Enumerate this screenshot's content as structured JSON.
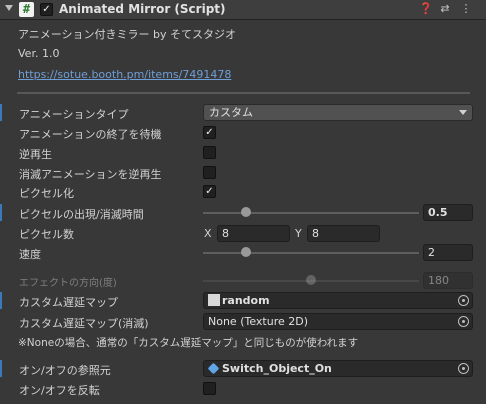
{
  "header": {
    "title": "Animated Mirror (Script)",
    "icons": [
      "fold-arrow-icon",
      "script-icon",
      "help-icon",
      "preset-icon",
      "kebab-menu-icon"
    ],
    "enabled": true
  },
  "info": {
    "description": "アニメーション付きミラー by そてスタジオ",
    "version": "Ver. 1.0",
    "link": "https://sotue.booth.pm/items/7491478"
  },
  "props": {
    "anim_type": {
      "label": "アニメーションタイプ",
      "value": "カスタム"
    },
    "wait_end": {
      "label": "アニメーションの終了を待機",
      "checked": true
    },
    "reverse": {
      "label": "逆再生",
      "checked": false
    },
    "reverse_vanish": {
      "label": "消滅アニメーションを逆再生",
      "checked": false
    },
    "pixelate": {
      "label": "ピクセル化",
      "checked": true
    },
    "pixel_time": {
      "label": "ピクセルの出現/消滅時間",
      "value": "0.5",
      "fraction": 0.2
    },
    "pixel_count": {
      "label": "ピクセル数",
      "x_label": "X",
      "x": "8",
      "y_label": "Y",
      "y": "8"
    },
    "speed": {
      "label": "速度",
      "value": "2",
      "fraction": 0.2
    },
    "effect_dir": {
      "label": "エフェクトの方向(度)",
      "value": "180",
      "fraction": 0.5
    },
    "custom_delay": {
      "label": "カスタム遅延マップ",
      "value": "random"
    },
    "custom_delay_vanish": {
      "label": "カスタム遅延マップ(消滅)",
      "value": "None (Texture 2D)"
    },
    "note": "※Noneの場合、通常の「カスタム遅延マップ」と同じものが使われます",
    "toggle_ref": {
      "label": "オン/オフの参照元",
      "value": "Switch_Object_On"
    },
    "invert_toggle": {
      "label": "オン/オフを反転",
      "checked": false
    }
  },
  "colors": {
    "background": "#383838",
    "field": "#2a2a2a",
    "accent": "#3a79bb",
    "link": "#6f9fd8"
  }
}
